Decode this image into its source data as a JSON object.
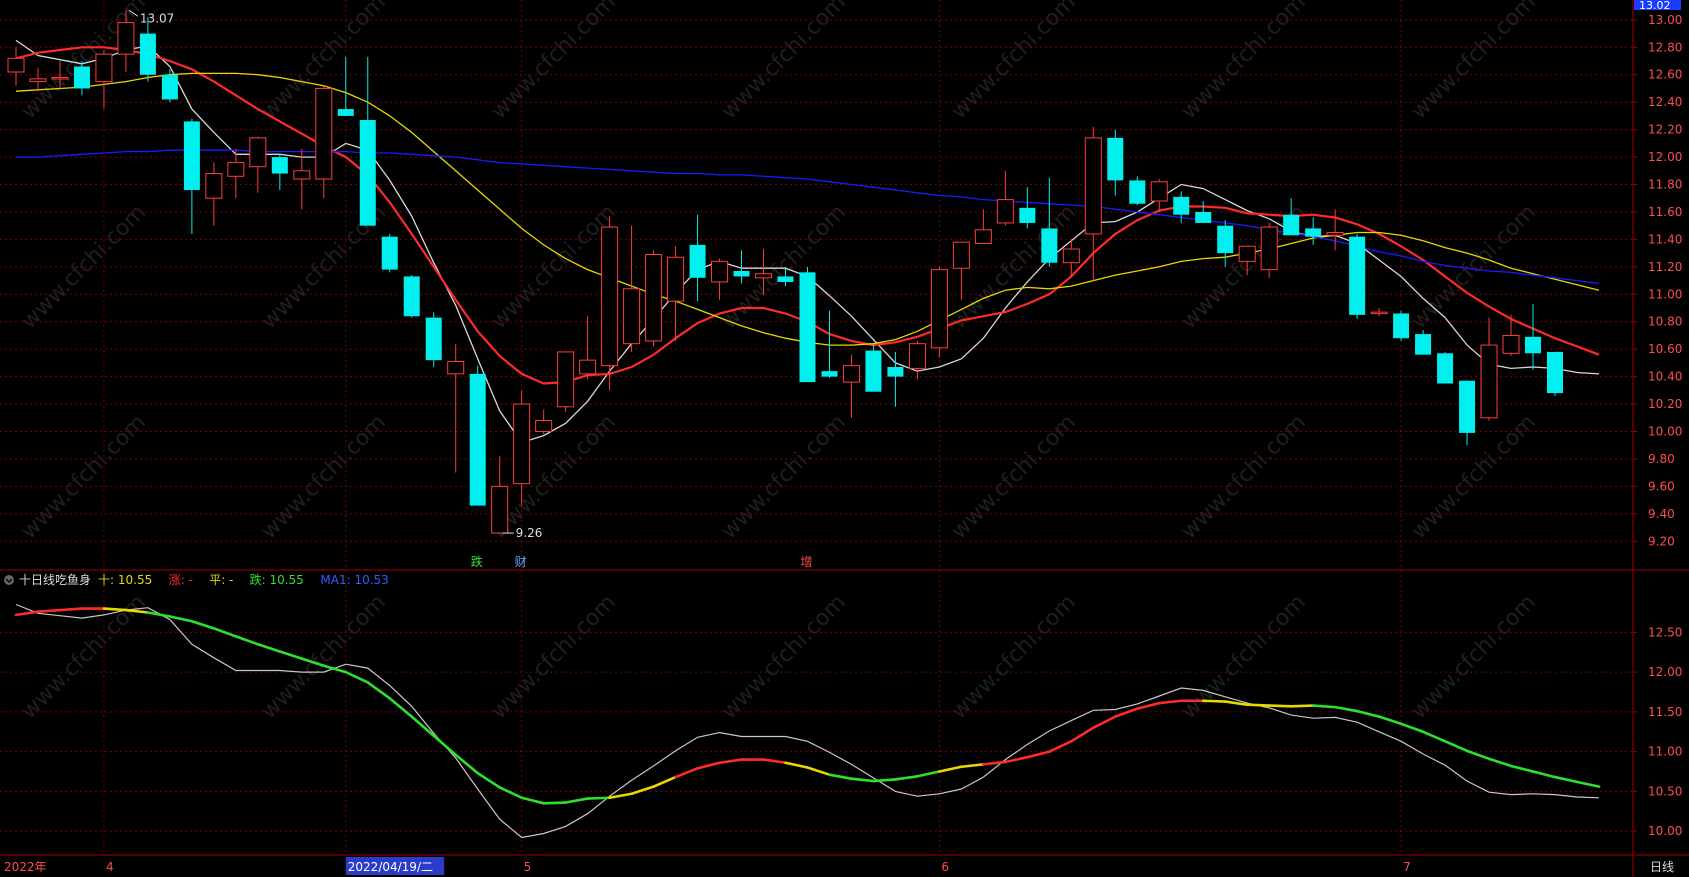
{
  "chart_data": [
    {
      "type": "candlestick",
      "title": "",
      "period_label": "日线",
      "last_price_badge": "13.02",
      "yticks": [
        "13.00",
        "12.80",
        "12.60",
        "12.40",
        "12.20",
        "12.00",
        "11.80",
        "11.60",
        "11.40",
        "11.20",
        "11.00",
        "10.80",
        "10.60",
        "10.40",
        "10.20",
        "10.00",
        "9.80",
        "9.60",
        "9.40",
        "9.20"
      ],
      "ylim": [
        9.1,
        13.05
      ],
      "high_annotation": "13.07",
      "low_annotation": "9.26",
      "event_markers": [
        {
          "index": 21,
          "text": "跌",
          "color": "#3ce03c"
        },
        {
          "index": 23,
          "text": "财",
          "color": "#66aaff"
        },
        {
          "index": 36,
          "text": "增",
          "color": "#ff4d4d"
        }
      ],
      "candles": [
        {
          "o": 12.62,
          "h": 12.8,
          "l": 12.52,
          "c": 12.72
        },
        {
          "o": 12.55,
          "h": 12.65,
          "l": 12.48,
          "c": 12.57
        },
        {
          "o": 12.57,
          "h": 12.7,
          "l": 12.5,
          "c": 12.58
        },
        {
          "o": 12.66,
          "h": 12.7,
          "l": 12.45,
          "c": 12.5
        },
        {
          "o": 12.55,
          "h": 12.78,
          "l": 12.35,
          "c": 12.75
        },
        {
          "o": 12.75,
          "h": 13.07,
          "l": 12.62,
          "c": 12.98
        },
        {
          "o": 12.9,
          "h": 13.02,
          "l": 12.55,
          "c": 12.6
        },
        {
          "o": 12.6,
          "h": 12.64,
          "l": 12.4,
          "c": 12.42
        },
        {
          "o": 12.26,
          "h": 12.28,
          "l": 11.44,
          "c": 11.76
        },
        {
          "o": 11.7,
          "h": 11.96,
          "l": 11.5,
          "c": 11.88
        },
        {
          "o": 11.86,
          "h": 12.06,
          "l": 11.7,
          "c": 11.96
        },
        {
          "o": 11.93,
          "h": 12.15,
          "l": 11.74,
          "c": 12.14
        },
        {
          "o": 12.0,
          "h": 12.02,
          "l": 11.76,
          "c": 11.88
        },
        {
          "o": 11.84,
          "h": 12.06,
          "l": 11.62,
          "c": 11.9
        },
        {
          "o": 11.84,
          "h": 12.52,
          "l": 11.7,
          "c": 12.5
        },
        {
          "o": 12.35,
          "h": 12.73,
          "l": 12.3,
          "c": 12.3
        },
        {
          "o": 12.27,
          "h": 12.73,
          "l": 11.6,
          "c": 11.5
        },
        {
          "o": 11.42,
          "h": 11.44,
          "l": 11.16,
          "c": 11.18
        },
        {
          "o": 11.13,
          "h": 11.14,
          "l": 10.83,
          "c": 10.84
        },
        {
          "o": 10.83,
          "h": 10.87,
          "l": 10.47,
          "c": 10.52
        },
        {
          "o": 10.42,
          "h": 10.64,
          "l": 9.7,
          "c": 10.51
        },
        {
          "o": 10.42,
          "h": 10.48,
          "l": 9.46,
          "c": 9.46
        },
        {
          "o": 9.26,
          "h": 9.82,
          "l": 9.26,
          "c": 9.6
        },
        {
          "o": 9.62,
          "h": 10.3,
          "l": 9.46,
          "c": 10.2
        },
        {
          "o": 10.0,
          "h": 10.16,
          "l": 9.98,
          "c": 10.08
        },
        {
          "o": 10.18,
          "h": 10.58,
          "l": 10.14,
          "c": 10.58
        },
        {
          "o": 10.42,
          "h": 10.84,
          "l": 10.38,
          "c": 10.52
        },
        {
          "o": 10.48,
          "h": 11.57,
          "l": 10.3,
          "c": 11.49
        },
        {
          "o": 10.64,
          "h": 11.5,
          "l": 10.58,
          "c": 11.04
        },
        {
          "o": 10.66,
          "h": 11.32,
          "l": 10.62,
          "c": 11.29
        },
        {
          "o": 10.95,
          "h": 11.35,
          "l": 10.66,
          "c": 11.27
        },
        {
          "o": 11.36,
          "h": 11.58,
          "l": 10.95,
          "c": 11.12
        },
        {
          "o": 11.09,
          "h": 11.26,
          "l": 10.96,
          "c": 11.24
        },
        {
          "o": 11.17,
          "h": 11.32,
          "l": 11.08,
          "c": 11.13
        },
        {
          "o": 11.12,
          "h": 11.33,
          "l": 11.0,
          "c": 11.15
        },
        {
          "o": 11.13,
          "h": 11.2,
          "l": 11.06,
          "c": 11.09
        },
        {
          "o": 11.16,
          "h": 11.2,
          "l": 10.36,
          "c": 10.36
        },
        {
          "o": 10.44,
          "h": 10.88,
          "l": 10.39,
          "c": 10.4
        },
        {
          "o": 10.36,
          "h": 10.56,
          "l": 10.1,
          "c": 10.48
        },
        {
          "o": 10.59,
          "h": 10.64,
          "l": 10.33,
          "c": 10.29
        },
        {
          "o": 10.47,
          "h": 10.58,
          "l": 10.18,
          "c": 10.4
        },
        {
          "o": 10.46,
          "h": 10.66,
          "l": 10.38,
          "c": 10.64
        },
        {
          "o": 10.61,
          "h": 11.2,
          "l": 10.54,
          "c": 11.18
        },
        {
          "o": 11.19,
          "h": 11.36,
          "l": 10.96,
          "c": 11.38
        },
        {
          "o": 11.37,
          "h": 11.62,
          "l": 11.38,
          "c": 11.47
        },
        {
          "o": 11.52,
          "h": 11.9,
          "l": 11.5,
          "c": 11.69
        },
        {
          "o": 11.63,
          "h": 11.78,
          "l": 11.48,
          "c": 11.52
        },
        {
          "o": 11.48,
          "h": 11.85,
          "l": 11.2,
          "c": 11.23
        },
        {
          "o": 11.23,
          "h": 11.4,
          "l": 11.12,
          "c": 11.33
        },
        {
          "o": 11.44,
          "h": 12.22,
          "l": 11.1,
          "c": 12.14
        },
        {
          "o": 12.14,
          "h": 12.2,
          "l": 11.72,
          "c": 11.83
        },
        {
          "o": 11.83,
          "h": 11.86,
          "l": 11.65,
          "c": 11.66
        },
        {
          "o": 11.68,
          "h": 11.84,
          "l": 11.6,
          "c": 11.82
        },
        {
          "o": 11.71,
          "h": 11.75,
          "l": 11.52,
          "c": 11.58
        },
        {
          "o": 11.6,
          "h": 11.68,
          "l": 11.52,
          "c": 11.52
        },
        {
          "o": 11.5,
          "h": 11.54,
          "l": 11.2,
          "c": 11.3
        },
        {
          "o": 11.24,
          "h": 11.35,
          "l": 11.14,
          "c": 11.35
        },
        {
          "o": 11.18,
          "h": 11.52,
          "l": 11.12,
          "c": 11.49
        },
        {
          "o": 11.58,
          "h": 11.7,
          "l": 11.44,
          "c": 11.43
        },
        {
          "o": 11.48,
          "h": 11.56,
          "l": 11.36,
          "c": 11.42
        },
        {
          "o": 11.43,
          "h": 11.62,
          "l": 11.32,
          "c": 11.45
        },
        {
          "o": 11.42,
          "h": 11.44,
          "l": 10.82,
          "c": 10.85
        },
        {
          "o": 10.86,
          "h": 10.9,
          "l": 10.84,
          "c": 10.87
        },
        {
          "o": 10.86,
          "h": 10.88,
          "l": 10.66,
          "c": 10.68
        },
        {
          "o": 10.71,
          "h": 10.74,
          "l": 10.58,
          "c": 10.56
        },
        {
          "o": 10.57,
          "h": 10.58,
          "l": 10.37,
          "c": 10.35
        },
        {
          "o": 10.37,
          "h": 10.37,
          "l": 9.9,
          "c": 9.99
        },
        {
          "o": 10.1,
          "h": 10.83,
          "l": 10.08,
          "c": 10.63
        },
        {
          "o": 10.57,
          "h": 10.85,
          "l": 10.55,
          "c": 10.7
        },
        {
          "o": 10.69,
          "h": 10.93,
          "l": 10.45,
          "c": 10.57
        },
        {
          "o": 10.58,
          "h": 10.58,
          "l": 10.26,
          "c": 10.28
        }
      ],
      "series": [
        {
          "line": "ma_white",
          "color": "#d8d8d8",
          "values": [
            12.85,
            12.74,
            12.71,
            12.68,
            12.72,
            12.78,
            12.81,
            12.66,
            12.35,
            12.18,
            12.02,
            12.02,
            12.02,
            12.0,
            12.0,
            12.1,
            12.05,
            11.83,
            11.57,
            11.23,
            10.92,
            10.53,
            10.15,
            9.92,
            9.97,
            10.06,
            10.22,
            10.44,
            10.64,
            10.82,
            11.01,
            11.18,
            11.24,
            11.19,
            11.19,
            11.19,
            11.13,
            10.99,
            10.84,
            10.67,
            10.5,
            10.44,
            10.47,
            10.53,
            10.68,
            10.9,
            11.09,
            11.26,
            11.39,
            11.52,
            11.53,
            11.6,
            11.7,
            11.8,
            11.77,
            11.69,
            11.61,
            11.55,
            11.46,
            11.42,
            11.43,
            11.37,
            11.25,
            11.13,
            10.97,
            10.83,
            10.63,
            10.49,
            10.46,
            10.47,
            10.46,
            10.43,
            10.42
          ]
        },
        {
          "line": "ma_red",
          "color": "#ff2a2a",
          "values": [
            12.72,
            12.76,
            12.78,
            12.8,
            12.8,
            12.78,
            12.75,
            12.7,
            12.64,
            12.55,
            12.45,
            12.35,
            12.26,
            12.17,
            12.08,
            12.0,
            11.87,
            11.67,
            11.44,
            11.2,
            10.96,
            10.73,
            10.55,
            10.42,
            10.35,
            10.36,
            10.41,
            10.42,
            10.47,
            10.56,
            10.68,
            10.79,
            10.86,
            10.9,
            10.9,
            10.86,
            10.8,
            10.71,
            10.66,
            10.63,
            10.65,
            10.69,
            10.75,
            10.81,
            10.84,
            10.87,
            10.93,
            11.0,
            11.13,
            11.3,
            11.44,
            11.54,
            11.61,
            11.64,
            11.64,
            11.63,
            11.59,
            11.58,
            11.57,
            11.58,
            11.56,
            11.51,
            11.44,
            11.35,
            11.25,
            11.13,
            11.01,
            10.91,
            10.82,
            10.75,
            10.68,
            10.62,
            10.56
          ]
        },
        {
          "line": "ma_yellow",
          "color": "#e8d800",
          "values": [
            12.48,
            12.49,
            12.5,
            12.51,
            12.53,
            12.55,
            12.58,
            12.6,
            12.61,
            12.61,
            12.61,
            12.6,
            12.58,
            12.55,
            12.52,
            12.47,
            12.4,
            12.3,
            12.18,
            12.04,
            11.9,
            11.76,
            11.62,
            11.48,
            11.36,
            11.26,
            11.18,
            11.12,
            11.06,
            11.0,
            10.95,
            10.89,
            10.83,
            10.77,
            10.72,
            10.68,
            10.65,
            10.63,
            10.63,
            10.64,
            10.67,
            10.73,
            10.81,
            10.89,
            10.97,
            11.03,
            11.05,
            11.04,
            11.06,
            11.1,
            11.14,
            11.17,
            11.2,
            11.24,
            11.26,
            11.27,
            11.3,
            11.33,
            11.37,
            11.41,
            11.43,
            11.45,
            11.45,
            11.43,
            11.39,
            11.34,
            11.3,
            11.25,
            11.19,
            11.15,
            11.11,
            11.07,
            11.03
          ]
        },
        {
          "line": "ma_blue",
          "color": "#1a1aff",
          "values": [
            12.0,
            12.0,
            12.01,
            12.02,
            12.03,
            12.04,
            12.04,
            12.05,
            12.05,
            12.05,
            12.05,
            12.04,
            12.04,
            12.04,
            12.04,
            12.04,
            12.03,
            12.03,
            12.02,
            12.01,
            12.0,
            11.98,
            11.96,
            11.95,
            11.94,
            11.93,
            11.92,
            11.91,
            11.9,
            11.89,
            11.88,
            11.88,
            11.87,
            11.87,
            11.86,
            11.85,
            11.84,
            11.82,
            11.8,
            11.78,
            11.76,
            11.74,
            11.72,
            11.71,
            11.69,
            11.68,
            11.67,
            11.66,
            11.65,
            11.64,
            11.62,
            11.6,
            11.58,
            11.56,
            11.54,
            11.52,
            11.5,
            11.47,
            11.45,
            11.42,
            11.39,
            11.35,
            11.31,
            11.28,
            11.24,
            11.21,
            11.19,
            11.17,
            11.16,
            11.14,
            11.12,
            11.1,
            11.08
          ]
        }
      ]
    },
    {
      "type": "line",
      "title": "十日线吃鱼身",
      "legend": [
        {
          "label": "十: 10.55",
          "color": "#e8d800"
        },
        {
          "label": "涨: -",
          "color": "#ff2a2a"
        },
        {
          "label": "平: -",
          "color": "#e8d800"
        },
        {
          "label": "跌: 10.55",
          "color": "#2ee02e"
        },
        {
          "label": "MA1: 10.53",
          "color": "#2f5dff"
        }
      ],
      "yticks": [
        "12.50",
        "12.00",
        "11.50",
        "11.00",
        "10.50",
        "10.00"
      ],
      "ylim": [
        9.7,
        12.97
      ],
      "ten_line_trend": [
        "up",
        "up",
        "up",
        "up",
        "flat",
        "flat",
        "down",
        "down",
        "down",
        "down",
        "down",
        "down",
        "down",
        "down",
        "down",
        "down",
        "down",
        "down",
        "down",
        "down",
        "down",
        "down",
        "down",
        "down",
        "down",
        "down",
        "down",
        "flat",
        "flat",
        "flat",
        "up",
        "up",
        "up",
        "up",
        "up",
        "flat",
        "flat",
        "down",
        "down",
        "down",
        "down",
        "down",
        "flat",
        "flat",
        "up",
        "up",
        "up",
        "up",
        "up",
        "up",
        "up",
        "up",
        "up",
        "up",
        "flat",
        "flat",
        "flat",
        "flat",
        "flat",
        "down",
        "down",
        "down",
        "down",
        "down",
        "down",
        "down",
        "down",
        "down",
        "down",
        "down",
        "down",
        "down",
        "down"
      ]
    }
  ],
  "x_axis": {
    "labels": [
      {
        "index": 0,
        "text": "2022年"
      },
      {
        "index": 4,
        "text": "4"
      },
      {
        "index": 15,
        "text": "2022/04/19/二",
        "highlight": true
      },
      {
        "index": 23,
        "text": "5"
      },
      {
        "index": 42,
        "text": "6"
      },
      {
        "index": 63,
        "text": "7"
      }
    ]
  },
  "watermark": "www.cfchi.com"
}
